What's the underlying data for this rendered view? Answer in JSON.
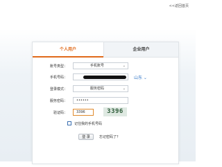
{
  "header": {
    "back_home": "<<返回首页"
  },
  "tabs": [
    {
      "label": "个人用户"
    },
    {
      "label": "企业用户"
    }
  ],
  "form": {
    "account_type": {
      "label": "账号类型：",
      "value": "手机账号"
    },
    "phone": {
      "label": "手机号码：",
      "value": ""
    },
    "province": {
      "label": "山东"
    },
    "login_mode": {
      "label": "登录模式：",
      "value": "服务密码"
    },
    "password": {
      "label": "服务密码：",
      "value": "••••••"
    },
    "captcha": {
      "label": "验证码：",
      "value": "3396",
      "image_text": "3396"
    },
    "remember": {
      "label": "记住我的手机号码"
    },
    "login_button": "登 录",
    "forgot": "忘记密码了？"
  },
  "colors": {
    "accent_orange": "#e06a1a",
    "link_blue": "#3a7bc8"
  }
}
